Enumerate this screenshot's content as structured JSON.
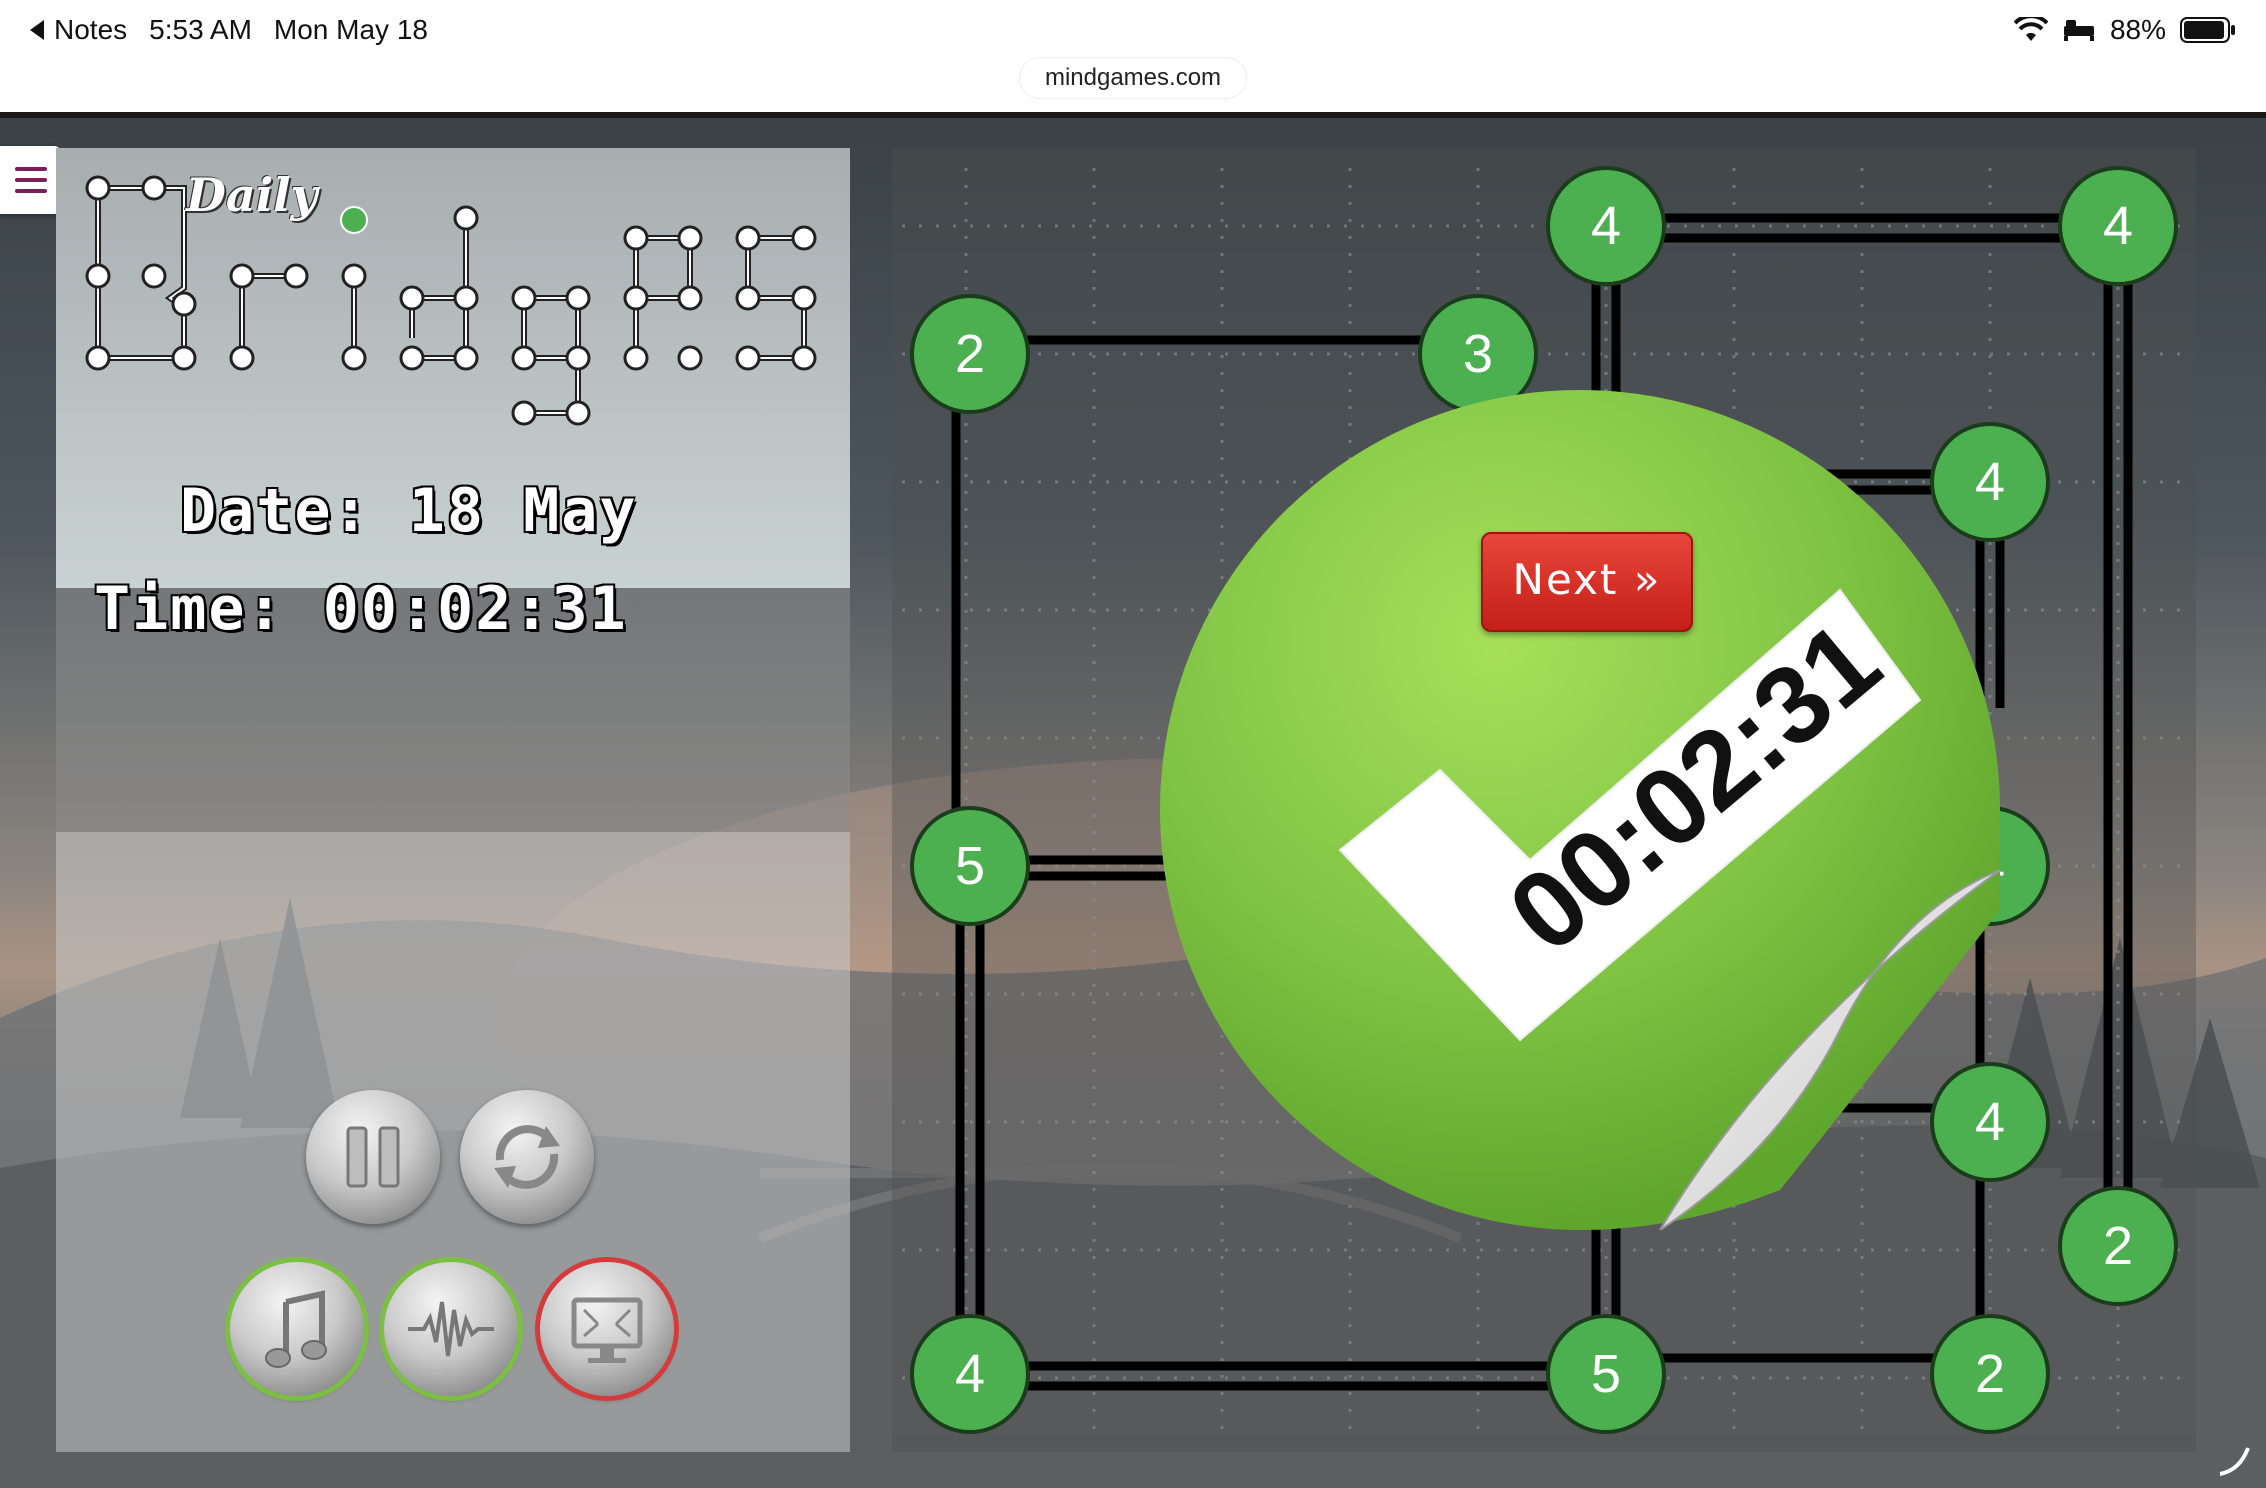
{
  "statusbar": {
    "back_label": "Notes",
    "time": "5:53 AM",
    "date": "Mon May 18",
    "battery": "88%",
    "url": "mindgames.com"
  },
  "logo": {
    "daily": "Daily",
    "title": "Bridges"
  },
  "info": {
    "date_label": "Date: 18 May",
    "time_label": "Time: 00:02:31"
  },
  "controls": [
    {
      "name": "pause",
      "icon": "pause-icon"
    },
    {
      "name": "restart",
      "icon": "restart-icon"
    },
    {
      "name": "music",
      "icon": "music-note-icon",
      "state": "on"
    },
    {
      "name": "sound",
      "icon": "sound-wave-icon",
      "state": "on"
    },
    {
      "name": "fullscreen",
      "icon": "monitor-icon",
      "state": "off"
    }
  ],
  "board": {
    "islands": [
      {
        "value": "4"
      },
      {
        "value": "4"
      },
      {
        "value": "2"
      },
      {
        "value": "3"
      },
      {
        "value": "4"
      },
      {
        "value": "5"
      },
      {
        "value": "4"
      },
      {
        "value": "4"
      },
      {
        "value": "2"
      },
      {
        "value": "4"
      },
      {
        "value": "5"
      },
      {
        "value": "2"
      }
    ]
  },
  "result": {
    "time": "00:02:31",
    "next_label": "Next »"
  },
  "colors": {
    "island": "#4caf50",
    "next_button": "#d9322a",
    "sticker": "#8dd14a",
    "menu_icon": "#7a1f5c"
  }
}
